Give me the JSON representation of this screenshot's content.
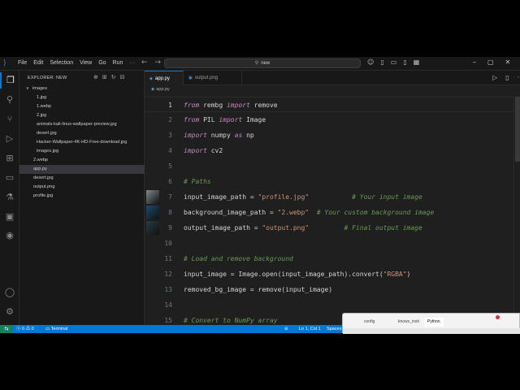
{
  "titlebar": {
    "menu": [
      "File",
      "Edit",
      "Selection",
      "View",
      "Go",
      "Run"
    ],
    "search": "new"
  },
  "sidebar": {
    "header": "EXPLORER: NEW",
    "items": [
      {
        "label": "images",
        "type": "folder",
        "depth": 0,
        "expanded": true
      },
      {
        "label": "1.jpg",
        "type": "file",
        "depth": 1
      },
      {
        "label": "1.webp",
        "type": "file",
        "depth": 1
      },
      {
        "label": "2.jpg",
        "type": "file",
        "depth": 1
      },
      {
        "label": "animals-kali-linux-wallpaper-preview.jpg",
        "type": "file",
        "depth": 1
      },
      {
        "label": "desert.jpg",
        "type": "file",
        "depth": 1
      },
      {
        "label": "Hacker-Wallpaper-4K-HD-Free-download.jpg",
        "type": "file",
        "depth": 1
      },
      {
        "label": "images.jpg",
        "type": "file",
        "depth": 1
      },
      {
        "label": "2.webp",
        "type": "file",
        "depth": 0
      },
      {
        "label": "app.py",
        "type": "file",
        "depth": 0,
        "selected": true
      },
      {
        "label": "desert.jpg",
        "type": "file",
        "depth": 0
      },
      {
        "label": "output.png",
        "type": "file",
        "depth": 0
      },
      {
        "label": "profile.jpg",
        "type": "file",
        "depth": 0
      }
    ]
  },
  "editor": {
    "tabs": [
      {
        "label": "app.py",
        "active": true
      },
      {
        "label": "output.png",
        "active": false
      }
    ],
    "breadcrumb": "app.py",
    "lines": [
      {
        "n": "1",
        "html": "<span class=\"kw\">from</span> rembg <span class=\"kw\">import</span> remove",
        "current": true
      },
      {
        "n": "2",
        "html": "<span class=\"kw\">from</span> PIL <span class=\"kw\">import</span> Image"
      },
      {
        "n": "3",
        "html": "<span class=\"kw\">import</span> numpy <span class=\"kw\">as</span> np"
      },
      {
        "n": "4",
        "html": "<span class=\"kw\">import</span> cv2"
      },
      {
        "n": "5",
        "html": ""
      },
      {
        "n": "6",
        "html": "<span class=\"cmt\"># Paths</span>"
      },
      {
        "n": "7",
        "html": "input_image_path = <span class=\"str\">\"profile.jpg\"</span>           <span class=\"cmt\"># Your input image</span>",
        "thumb": "profile"
      },
      {
        "n": "8",
        "html": "background_image_path = <span class=\"str\">\"2.webp\"</span>  <span class=\"cmt\"># Your custom background image</span>",
        "thumb": "bg"
      },
      {
        "n": "9",
        "html": "output_image_path = <span class=\"str\">\"output.png\"</span>         <span class=\"cmt\"># Final output image</span>",
        "thumb": "out"
      },
      {
        "n": "10",
        "html": ""
      },
      {
        "n": "11",
        "html": "<span class=\"cmt\"># Load and remove background</span>"
      },
      {
        "n": "12",
        "html": "input_image = Image.open(input_image_path).convert(<span class=\"str\">\"RGBA\"</span>)"
      },
      {
        "n": "13",
        "html": "removed_bg_image = remove(input_image)"
      },
      {
        "n": "14",
        "html": ""
      },
      {
        "n": "15",
        "html": "<span class=\"cmt\"># Convert to NumPy array</span>"
      }
    ]
  },
  "statusbar": {
    "errors": "0",
    "warnings": "0",
    "terminal": "Terminal",
    "zoom": "⊖",
    "position": "Ln 1, Col 1",
    "spaces": "Spaces"
  },
  "overlay": {
    "tabs": [
      "config",
      "knows_insti",
      "Python"
    ]
  },
  "colors": {
    "accent": "#0078d4",
    "keyword": "#c586c0",
    "string": "#ce9178",
    "comment": "#6a9955"
  }
}
